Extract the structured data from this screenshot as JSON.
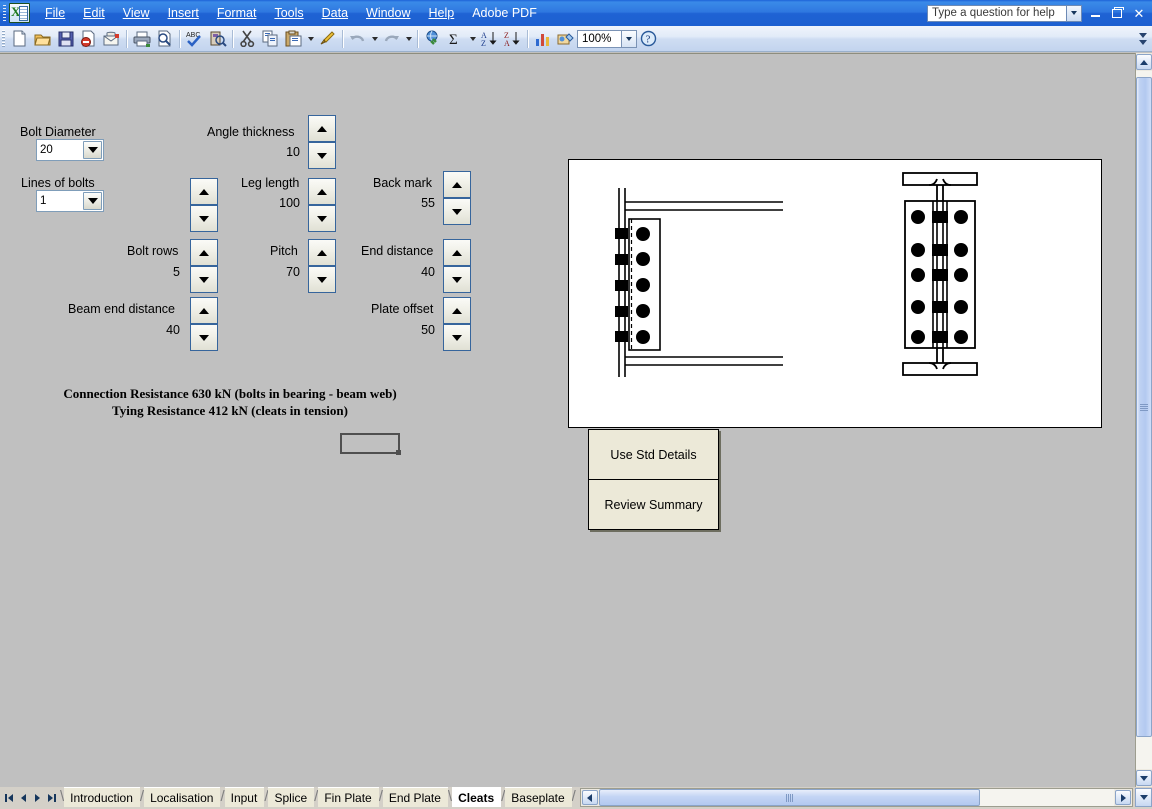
{
  "window": {
    "app_icon": "excel-icon",
    "help_search_value": "Type a question for help",
    "minimize_label": "Minimize",
    "restore_label": "Restore",
    "close_label": "Close"
  },
  "menubar": {
    "items": [
      {
        "label": "File",
        "accel": "F"
      },
      {
        "label": "Edit",
        "accel": "E"
      },
      {
        "label": "View",
        "accel": "V"
      },
      {
        "label": "Insert",
        "accel": "I"
      },
      {
        "label": "Format",
        "accel": "o"
      },
      {
        "label": "Tools",
        "accel": "T"
      },
      {
        "label": "Data",
        "accel": "D"
      },
      {
        "label": "Window",
        "accel": "W"
      },
      {
        "label": "Help",
        "accel": "H"
      },
      {
        "label": "Adobe PDF",
        "accel": "b"
      }
    ]
  },
  "toolbar": {
    "zoom_value": "100%",
    "buttons": [
      "new-document-icon",
      "open-folder-icon",
      "save-disk-icon",
      "permission-icon",
      "email-icon",
      "print-icon",
      "print-preview-icon",
      "spelling-check-icon",
      "research-icon",
      "cut-scissors-icon",
      "copy-icon",
      "paste-icon",
      "format-painter-icon",
      "undo-icon",
      "redo-icon",
      "insert-hyperlink-icon",
      "autosum-icon",
      "sort-ascending-icon",
      "sort-descending-icon",
      "chart-wizard-icon",
      "drawing-icon",
      "help-icon"
    ]
  },
  "form": {
    "bolt_diameter": {
      "label": "Bolt Diameter",
      "value": "20"
    },
    "lines_of_bolts": {
      "label": "Lines of bolts",
      "value": "1"
    },
    "bolt_rows": {
      "label": "Bolt rows",
      "value": "5"
    },
    "beam_end_distance": {
      "label": "Beam end distance",
      "value": "40"
    },
    "angle_thickness": {
      "label": "Angle thickness",
      "value": "10"
    },
    "leg_length": {
      "label": "Leg length",
      "value": "100"
    },
    "pitch": {
      "label": "Pitch",
      "value": "70"
    },
    "back_mark": {
      "label": "Back mark",
      "value": "55"
    },
    "end_distance": {
      "label": "End distance",
      "value": "40"
    },
    "plate_offset": {
      "label": "Plate offset",
      "value": "50"
    }
  },
  "results": {
    "connection_resistance": "Connection Resistance 630 kN (bolts in bearing - beam web)",
    "tying_resistance": "Tying Resistance 412 kN (cleats in tension)"
  },
  "actions": {
    "use_std_details": "Use Std Details",
    "review_summary": "Review Summary"
  },
  "drawing": {
    "name": "cleat-connection-detail",
    "elevation_view": {
      "bolt_rows": 5,
      "bolt_columns": 1
    },
    "section_view": {
      "bolt_rows": 5,
      "bolt_columns": 2
    }
  },
  "sheet_tabs": {
    "items": [
      {
        "label": "Introduction",
        "active": false
      },
      {
        "label": "Localisation",
        "active": false
      },
      {
        "label": "Input",
        "active": false
      },
      {
        "label": "Splice",
        "active": false
      },
      {
        "label": "Fin Plate",
        "active": false
      },
      {
        "label": "End Plate",
        "active": false
      },
      {
        "label": "Cleats",
        "active": true
      },
      {
        "label": "Baseplate",
        "active": false
      }
    ],
    "nav": [
      "first-sheet-icon",
      "previous-sheet-icon",
      "next-sheet-icon",
      "last-sheet-icon"
    ]
  },
  "colors": {
    "titlebar": "#1f63d4",
    "toolbar": "#dce7f7",
    "worksheet_bg": "#c0c0c0",
    "button_face": "#ece9d8",
    "tab_bar": "#d4d0c8"
  }
}
